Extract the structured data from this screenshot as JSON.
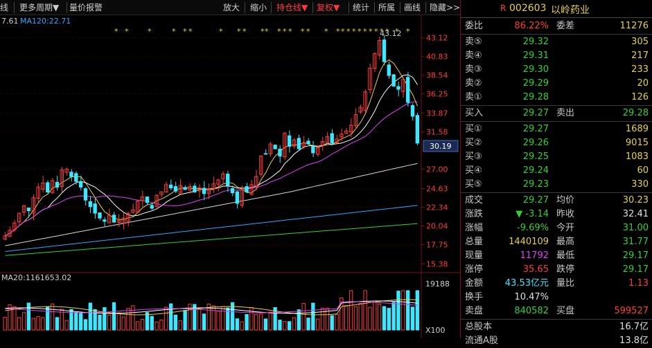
{
  "toolbar": {
    "items": [
      "线",
      "更多周期▼",
      "量价报警",
      "放大",
      "缩小",
      "持仓线▼",
      "复权▼",
      "统计",
      "所属",
      "画线",
      "隐藏>>"
    ]
  },
  "chart": {
    "ma_label_left": "7.61",
    "ma120_label": "MA120:22.71",
    "high_marker": "43.12",
    "y_ticks": [
      "43.12",
      "40.83",
      "38.54",
      "36.25",
      "33.87",
      "31.58",
      "27.00",
      "24.63",
      "22.34",
      "20.04",
      "17.75",
      "15.38"
    ],
    "current_price_tag": "30.19",
    "vol_label": "MA20:1161653.02",
    "vol_ticks": [
      "19188",
      "X100"
    ]
  },
  "chart_data": {
    "type": "candlestick",
    "y_axis_ticks": [
      43.12,
      40.83,
      38.54,
      36.25,
      33.87,
      31.58,
      27.0,
      24.63,
      22.34,
      20.04,
      17.75,
      15.38
    ],
    "ohlc_approx_close": [
      18.8,
      19.5,
      20.4,
      21.6,
      22.5,
      21.9,
      23.5,
      24.8,
      25.3,
      24.2,
      25.6,
      24.8,
      26.9,
      27.0,
      26.1,
      25.5,
      24.8,
      23.2,
      22.4,
      21.6,
      21.0,
      20.6,
      21.3,
      20.5,
      20.7,
      21.0,
      21.6,
      22.0,
      23.1,
      23.6,
      22.9,
      22.2,
      23.8,
      24.2,
      25.1,
      24.7,
      24.3,
      25.0,
      24.5,
      24.9,
      24.2,
      24.7,
      24.0,
      24.6,
      25.2,
      25.7,
      26.4,
      25.0,
      24.1,
      22.8,
      24.5,
      24.2,
      25.1,
      26.1,
      28.6,
      28.9,
      30.1,
      29.5,
      28.6,
      31.4,
      29.8,
      30.6,
      29.5,
      30.2,
      30.1,
      29.0,
      29.6,
      30.4,
      31.0,
      30.2,
      30.7,
      31.3,
      31.7,
      32.4,
      33.7,
      34.6,
      36.5,
      39.4,
      41.2,
      42.8,
      40.2,
      38.5,
      37.2,
      36.8,
      38.0,
      35.2,
      33.5,
      30.2
    ]
  },
  "header": {
    "code_prefix": "R",
    "code": "002603",
    "name": "以岭药业"
  },
  "wb": {
    "l1": "委比",
    "v1": "86.22%",
    "l2": "委差",
    "v2": "11276"
  },
  "asks": [
    {
      "l": "卖⑤",
      "p": "29.32",
      "q": "305"
    },
    {
      "l": "卖④",
      "p": "29.31",
      "q": "217"
    },
    {
      "l": "卖③",
      "p": "29.30",
      "q": "233"
    },
    {
      "l": "卖②",
      "p": "29.29",
      "q": "20"
    },
    {
      "l": "卖①",
      "p": "29.28",
      "q": "126"
    }
  ],
  "buysell": {
    "l1": "买入",
    "v1": "29.27",
    "l2": "卖出",
    "v2": "29.28"
  },
  "bids": [
    {
      "l": "买①",
      "p": "29.27",
      "q": "1689"
    },
    {
      "l": "买②",
      "p": "29.26",
      "q": "9015"
    },
    {
      "l": "买③",
      "p": "29.25",
      "q": "1083"
    },
    {
      "l": "买④",
      "p": "29.24",
      "q": "60"
    },
    {
      "l": "买⑤",
      "p": "29.23",
      "q": "330"
    }
  ],
  "stats": [
    {
      "l1": "成交",
      "v1": "29.27",
      "l2": "均价",
      "v2": "30.23"
    },
    {
      "l1": "涨跌",
      "v1": "▼ -3.14",
      "l2": "昨收",
      "v2": "32.41"
    },
    {
      "l1": "涨幅",
      "v1": "-9.69%",
      "l2": "今开",
      "v2": "31.00"
    },
    {
      "l1": "总量",
      "v1": "1440109",
      "l2": "最高",
      "v2": "31.77"
    },
    {
      "l1": "现量",
      "v1": "11792",
      "l2": "最低",
      "v2": "29.17"
    },
    {
      "l1": "涨停",
      "v1": "35.65",
      "l2": "跌停",
      "v2": "29.17"
    },
    {
      "l1": "金额",
      "v1": "43.53亿元",
      "l2": "量比",
      "v2": "1.13"
    },
    {
      "l1": "换手",
      "v1": "10.47%",
      "l2": "",
      "v2": ""
    },
    {
      "l1": "卖盘",
      "v1": "840582",
      "l2": "买盘",
      "v2": "599527"
    }
  ],
  "extra": [
    {
      "l": "总股本",
      "v": "16.7亿"
    },
    {
      "l": "流通A股",
      "v": "13.8亿"
    }
  ],
  "colors": {
    "up": "#ff3c3c",
    "down": "#3ce8ff",
    "ma5": "#ffffff",
    "ma10": "#e8d23c",
    "ma20": "#e040fb",
    "ma60": "#d8d8d8",
    "ma120": "#2aa8ff",
    "ma250": "#32d232"
  }
}
